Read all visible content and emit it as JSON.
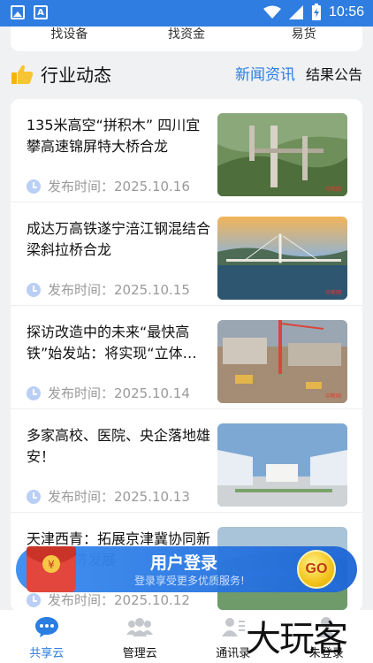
{
  "status_bar": {
    "time": "10:56",
    "icons": [
      "image-icon",
      "a-icon",
      "wifi-icon",
      "signal-icon",
      "battery-charging-icon"
    ]
  },
  "top_tiles": [
    {
      "label": "找设备"
    },
    {
      "label": "找资金"
    },
    {
      "label": "易货"
    }
  ],
  "section": {
    "title": "行业动态",
    "tabs": [
      {
        "label": "新闻资讯",
        "active": true
      },
      {
        "label": "结果公告",
        "active": false
      }
    ]
  },
  "news": [
    {
      "title": "135米高空“拼积木” 四川宜攀高速锦屏特大桥合龙",
      "date_label": "发布时间：2025.10.16",
      "image_caption": "中新网"
    },
    {
      "title": "成达万高铁遂宁涪江钢混结合梁斜拉桥合龙",
      "date_label": "发布时间：2025.10.15",
      "image_caption": "中新网"
    },
    {
      "title": "探访改造中的未来“最快高铁”始发站：将实现“立体…",
      "date_label": "发布时间：2025.10.14",
      "image_caption": "中新网"
    },
    {
      "title": "多家高校、医院、央企落地雄安！",
      "date_label": "发布时间：2025.10.13",
      "image_caption": ""
    },
    {
      "title": "天津西青：拓展京津冀协同新空间 经济发展",
      "date_label": "发布时间：2025.10.12",
      "image_caption": ""
    }
  ],
  "login_banner": {
    "title": "用户登录",
    "subtitle": "登录享受更多优质服务!",
    "go_label": "GO",
    "envelope_symbol": "¥"
  },
  "bottom_nav": [
    {
      "label": "共享云",
      "icon": "chat-bubble-icon",
      "active": true
    },
    {
      "label": "管理云",
      "icon": "group-icon",
      "active": false
    },
    {
      "label": "通讯录",
      "icon": "contacts-icon",
      "active": false
    },
    {
      "label": "未登录",
      "icon": "user-icon",
      "active": false
    }
  ],
  "watermark": "大玩客",
  "colors": {
    "brand_blue": "#2a7de1",
    "status_bar": "#2f7de1",
    "go_button": "#f3c21a",
    "envelope_red": "#e2463c"
  }
}
